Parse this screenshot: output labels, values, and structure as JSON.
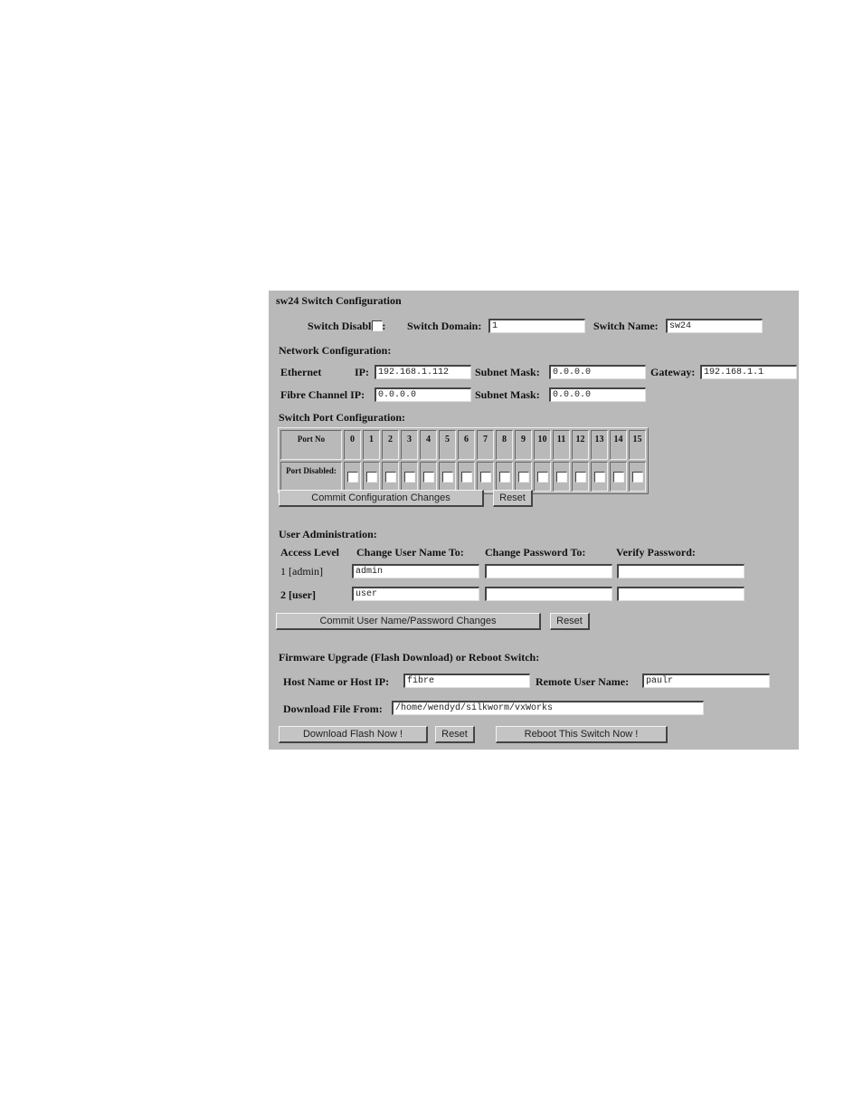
{
  "title": "sw24 Switch Configuration",
  "switch": {
    "disabled_label": "Switch Disabled:",
    "disabled_checked": false,
    "domain_label": "Switch Domain:",
    "domain_value": "1",
    "name_label": "Switch Name:",
    "name_value": "sw24"
  },
  "network": {
    "heading": "Network Configuration:",
    "ethernet_label": "Ethernet",
    "ip_label": "IP:",
    "ip_value": "192.168.1.112",
    "subnet_label": "Subnet Mask:",
    "subnet_value": "0.0.0.0",
    "gateway_label": "Gateway:",
    "gateway_value": "192.168.1.1",
    "fc_ip_label": "Fibre Channel IP:",
    "fc_ip_value": "0.0.0.0",
    "fc_subnet_label": "Subnet Mask:",
    "fc_subnet_value": "0.0.0.0"
  },
  "ports": {
    "heading": "Switch Port Configuration:",
    "port_no_label": "Port No",
    "port_disabled_label": "Port Disabled:",
    "numbers": [
      "0",
      "1",
      "2",
      "3",
      "4",
      "5",
      "6",
      "7",
      "8",
      "9",
      "10",
      "11",
      "12",
      "13",
      "14",
      "15"
    ],
    "commit_label": "Commit Configuration Changes",
    "reset_label": "Reset"
  },
  "users": {
    "heading": "User Administration:",
    "col_access": "Access Level",
    "col_username": "Change User Name To:",
    "col_password": "Change Password To:",
    "col_verify": "Verify Password:",
    "rows": [
      {
        "level": "1 [admin]",
        "username": "admin",
        "password": "",
        "verify": ""
      },
      {
        "level": "2 [user]",
        "username": "user",
        "password": "",
        "verify": ""
      }
    ],
    "commit_label": "Commit User Name/Password Changes",
    "reset_label": "Reset"
  },
  "firmware": {
    "heading": "Firmware Upgrade (Flash Download) or Reboot Switch:",
    "host_label": "Host Name or Host IP:",
    "host_value": "fibre",
    "remote_user_label": "Remote User Name:",
    "remote_user_value": "paulr",
    "file_label": "Download File From:",
    "file_value": "/home/wendyd/silkworm/vxWorks",
    "download_label": "Download Flash Now !",
    "reset_label": "Reset",
    "reboot_label": "Reboot This Switch Now !"
  }
}
